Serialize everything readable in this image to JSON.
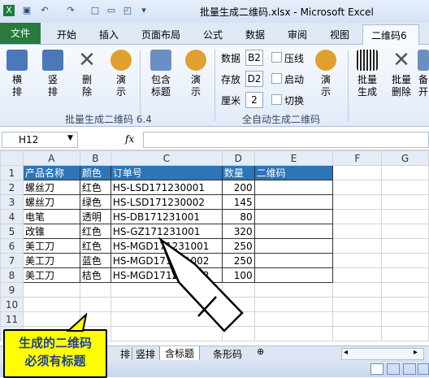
{
  "window": {
    "title": "批量生成二维码.xlsx - Microsoft Excel"
  },
  "ribbon_tabs": [
    "文件",
    "开始",
    "插入",
    "页面布局",
    "公式",
    "数据",
    "审阅",
    "视图",
    "二维码6"
  ],
  "ribbon": {
    "group1": {
      "buttons": [
        "横\n排",
        "竖\n排",
        "删\n除",
        "演\n示"
      ],
      "label": "批量生成二维码 6.4"
    },
    "group2": {
      "buttons": [
        "包含\n标题",
        "演\n示"
      ],
      "fields": [
        {
          "label": "数据",
          "value": "B2"
        },
        {
          "label": "存放",
          "value": "D2"
        },
        {
          "label": "厘米",
          "value": "2"
        }
      ],
      "checks": [
        "压线",
        "启动",
        "切换"
      ],
      "demo": "演\n示",
      "label": "全自动生成二维码"
    },
    "group3": {
      "buttons": [
        "批量\n生成",
        "批量\n删除",
        "备\n开"
      ]
    }
  },
  "formula_bar": {
    "name_box": "H12",
    "fx": "fx",
    "formula": ""
  },
  "columns": [
    "",
    "A",
    "B",
    "C",
    "D",
    "E",
    "F",
    "G"
  ],
  "rows": [
    [
      "1",
      "产品名称",
      "颜色",
      "订单号",
      "数量",
      "二维码"
    ],
    [
      "2",
      "螺丝刀",
      "红色",
      "HS-LSD171230001",
      "200",
      ""
    ],
    [
      "3",
      "螺丝刀",
      "绿色",
      "HS-LSD171230002",
      "145",
      ""
    ],
    [
      "4",
      "电笔",
      "透明",
      "HS-DB171231001",
      "80",
      ""
    ],
    [
      "5",
      "改锥",
      "红色",
      "HS-GZ171231001",
      "320",
      ""
    ],
    [
      "6",
      "美工刀",
      "红色",
      "HS-MGD171231001",
      "250",
      ""
    ],
    [
      "7",
      "美工刀",
      "蓝色",
      "HS-MGD171231002",
      "250",
      ""
    ],
    [
      "8",
      "美工刀",
      "桔色",
      "HS-MGD171231003",
      "100",
      ""
    ],
    [
      "9",
      "",
      "",
      "",
      "",
      ""
    ],
    [
      "10",
      "",
      "",
      "",
      "",
      ""
    ],
    [
      "11",
      "",
      "",
      "",
      "",
      ""
    ],
    [
      "12",
      "",
      "",
      "",
      "",
      ""
    ]
  ],
  "sheet_tabs": [
    "排",
    "竖排",
    "含标题",
    "条形码"
  ],
  "callout": {
    "line1": "生成的二维码",
    "line2": "必须有标题"
  },
  "colors": {
    "header_fill": "#2e75b6",
    "file_tab": "#2a7a3d",
    "callout": "#ffff00"
  }
}
